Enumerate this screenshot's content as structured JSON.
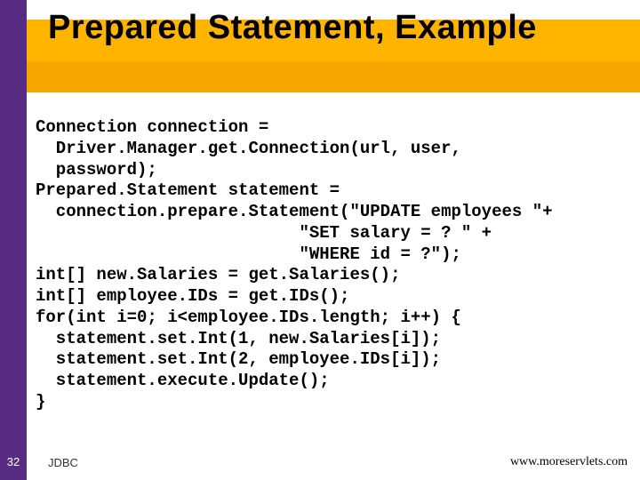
{
  "slide": {
    "title": "Prepared Statement, Example",
    "code": "Connection connection =\n  Driver.Manager.get.Connection(url, user,\n  password);\nPrepared.Statement statement =\n  connection.prepare.Statement(\"UPDATE employees \"+\n                          \"SET salary = ? \" +\n                          \"WHERE id = ?\");\nint[] new.Salaries = get.Salaries();\nint[] employee.IDs = get.IDs();\nfor(int i=0; i<employee.IDs.length; i++) {\n  statement.set.Int(1, new.Salaries[i]);\n  statement.set.Int(2, employee.IDs[i]);\n  statement.execute.Update();\n}"
  },
  "footer": {
    "page_number": "32",
    "topic": "JDBC",
    "url": "www.moreservlets.com"
  }
}
